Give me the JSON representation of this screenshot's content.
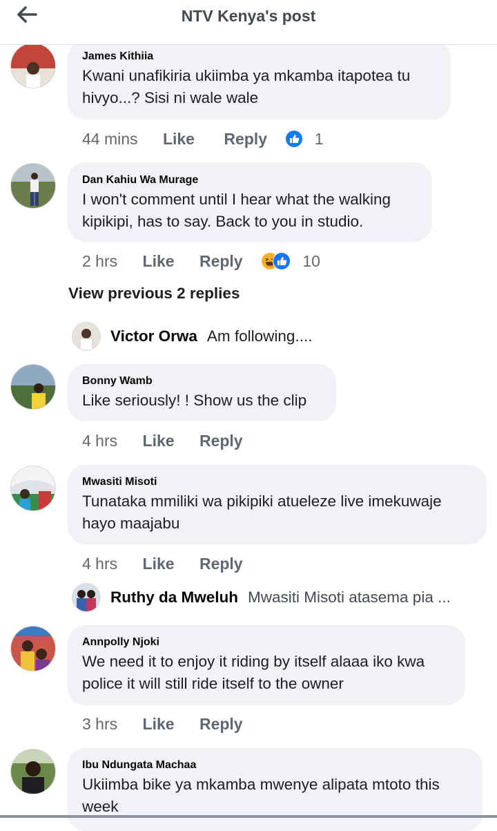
{
  "header": {
    "title": "NTV Kenya's post",
    "back_icon": "arrow-left-icon"
  },
  "colors": {
    "bubble": "#f0f2f5",
    "like_blue": "#1877f2",
    "meta_gray": "#65676b",
    "haha_yellow": "#f7b125"
  },
  "comments": [
    {
      "author": "James Kithiia",
      "text_lines": [
        "Kwani unafikiria ukiimba ya mkamba itapotea tu",
        "hivyo...?  Sisi ni wale wale"
      ],
      "time": "44 mins",
      "like": "Like",
      "reply": "Reply",
      "reactions": [
        "like"
      ],
      "reaction_count": "1"
    },
    {
      "author": "Dan Kahiu Wa Murage",
      "text_lines": [
        "I won't comment until I hear what the walking",
        "kipikipi, has to say. Back to you in studio."
      ],
      "time": "2 hrs",
      "like": "Like",
      "reply": "Reply",
      "reactions": [
        "haha",
        "like"
      ],
      "reaction_count": "10"
    },
    {
      "author": "Bonny Wamb",
      "text_lines": [
        "Like seriously! ! Show us the clip"
      ],
      "time": "4 hrs",
      "like": "Like",
      "reply": "Reply"
    },
    {
      "author": "Mwasiti Misoti",
      "text_lines": [
        "Tunataka mmiliki wa pikipiki atueleze live imekuwaje",
        "hayo maajabu"
      ],
      "time": "4 hrs",
      "like": "Like",
      "reply": "Reply"
    },
    {
      "author": "Annpolly Njoki",
      "text_lines": [
        "We need it to enjoy it riding by itself alaaa iko kwa",
        "police it will still ride itself to the owner"
      ],
      "time": "3 hrs",
      "like": "Like",
      "reply": "Reply"
    },
    {
      "author": "Ibu Ndungata Machaa",
      "text_lines": [
        "Ukiimba bike ya mkamba mwenye alipata mtoto this",
        "week"
      ]
    }
  ],
  "view_previous": "View previous 2 replies",
  "replies": [
    {
      "author": "Victor Orwa",
      "text": "Am following...."
    },
    {
      "author": "Ruthy da Mweluh",
      "text": "Mwasiti Misoti atasema pia ..."
    }
  ]
}
